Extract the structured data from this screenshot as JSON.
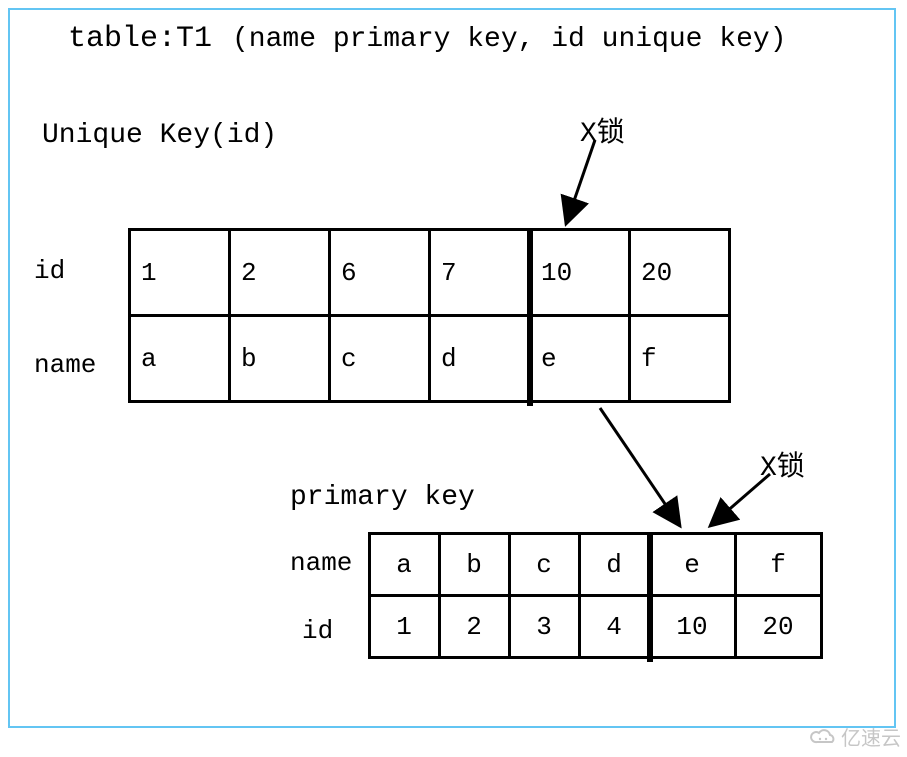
{
  "title_prefix": "table:T1",
  "title_suffix": "(name primary key, id unique key)",
  "unique_label": "Unique Key(id)",
  "primary_label": "primary key",
  "lock_label_top": "X锁",
  "lock_label_bottom": "X锁",
  "table1": {
    "row_labels": [
      "id",
      "name"
    ],
    "rows": [
      [
        "1",
        "2",
        "6",
        "7",
        "10",
        "20"
      ],
      [
        "a",
        "b",
        "c",
        "d",
        "e",
        "f"
      ]
    ],
    "highlight_col": 4
  },
  "table2": {
    "row_labels": [
      "name",
      "id"
    ],
    "rows": [
      [
        "a",
        "b",
        "c",
        "d",
        "e",
        "f"
      ],
      [
        "1",
        "2",
        "3",
        "4",
        "10",
        "20"
      ]
    ],
    "highlight_col": 4
  },
  "watermark": "亿速云"
}
